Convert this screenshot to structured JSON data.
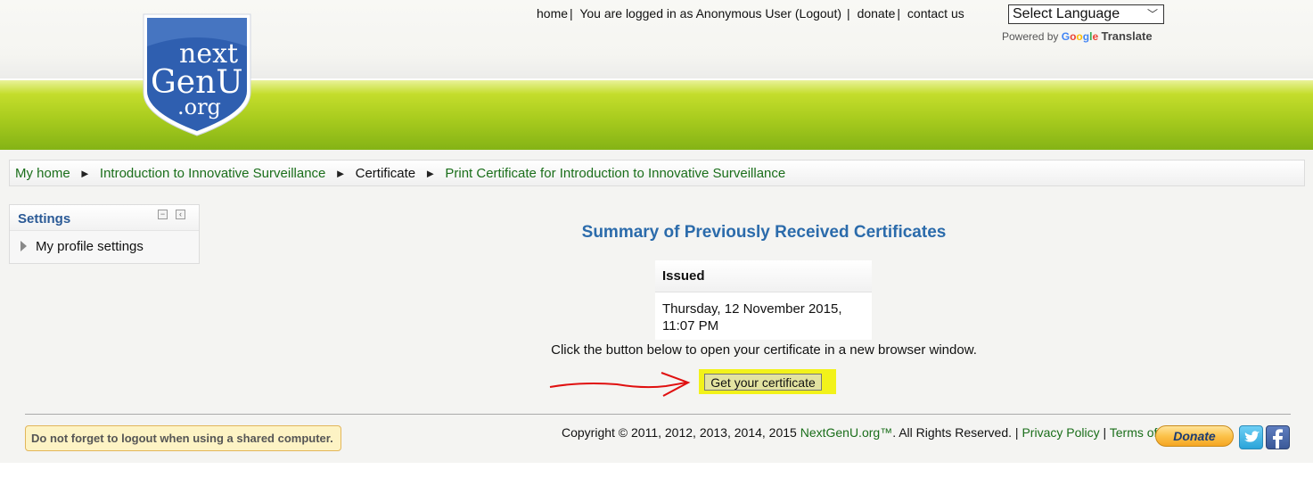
{
  "header": {
    "logo_text": [
      "next",
      "GenU",
      ".org"
    ],
    "links": [
      {
        "label": "home"
      },
      {
        "label": "You are logged in as"
      },
      {
        "label": "Anonymous User"
      },
      {
        "label": "(Logout)"
      },
      {
        "label": "donate"
      },
      {
        "label": "contact us"
      }
    ],
    "language": {
      "selected": "Select Language"
    },
    "powered_by": "Powered by",
    "google": "Google",
    "translate": "Translate"
  },
  "colors": {
    "brand_green": "#a9cc1e",
    "link_green": "#1a6e1a",
    "title_blue": "#2b6bab",
    "highlight_yellow": "#f2f21a",
    "arrow_red": "#e01010"
  },
  "breadcrumb": {
    "items": [
      {
        "label": "My home"
      },
      {
        "label": "Introduction to Innovative Surveillance"
      },
      {
        "label": "Certificate"
      },
      {
        "label": "Print Certificate for Introduction to Innovative Surveillance"
      }
    ],
    "separator": "►"
  },
  "settings_block": {
    "title": "Settings",
    "items": [
      {
        "label": "My profile settings"
      }
    ]
  },
  "main": {
    "title": "Summary of Previously Received Certificates",
    "table": {
      "header": "Issued",
      "rows": [
        {
          "issued_line1": "Thursday, 12 November 2015,",
          "issued_line2": "11:07 PM"
        }
      ]
    },
    "instruction": "Click the button below to open your certificate in a new browser window.",
    "button_label": "Get your certificate"
  },
  "footer": {
    "logout_note": "Do not forget to logout when using a shared computer.",
    "copyright_prefix": "Copyright © 2011, 2012, 2013, 2014, 2015",
    "brand_link": "NextGenU.org™",
    "rights": ". All Rights Reserved. |",
    "privacy": "Privacy Policy",
    "separator": "|",
    "terms": "Terms of Use",
    "donate": "Donate",
    "icons": [
      "twitter-icon",
      "facebook-icon"
    ]
  }
}
